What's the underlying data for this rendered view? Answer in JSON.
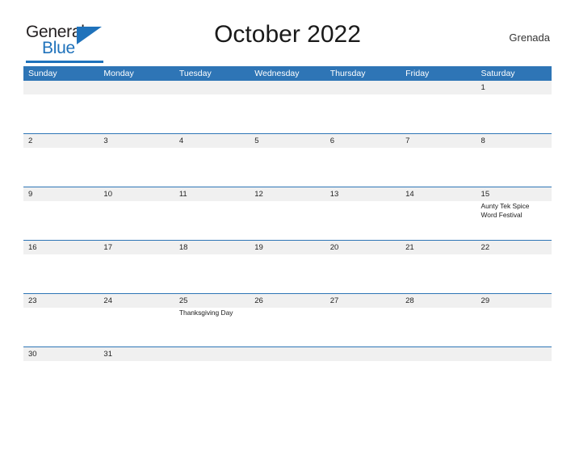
{
  "brand": {
    "name_part1": "General",
    "name_part2": "Blue"
  },
  "header": {
    "title": "October 2022",
    "location": "Grenada"
  },
  "calendar": {
    "weekdays": [
      "Sunday",
      "Monday",
      "Tuesday",
      "Wednesday",
      "Thursday",
      "Friday",
      "Saturday"
    ],
    "colors": {
      "header_blue": "#2E75B6",
      "band_gray": "#F0F0F0",
      "brand_blue": "#1F72BB",
      "text_dark": "#231F20"
    },
    "weeks": [
      {
        "days": [
          {
            "num": "",
            "events": []
          },
          {
            "num": "",
            "events": []
          },
          {
            "num": "",
            "events": []
          },
          {
            "num": "",
            "events": []
          },
          {
            "num": "",
            "events": []
          },
          {
            "num": "",
            "events": []
          },
          {
            "num": "1",
            "events": []
          }
        ]
      },
      {
        "days": [
          {
            "num": "2",
            "events": []
          },
          {
            "num": "3",
            "events": []
          },
          {
            "num": "4",
            "events": []
          },
          {
            "num": "5",
            "events": []
          },
          {
            "num": "6",
            "events": []
          },
          {
            "num": "7",
            "events": []
          },
          {
            "num": "8",
            "events": []
          }
        ]
      },
      {
        "days": [
          {
            "num": "9",
            "events": []
          },
          {
            "num": "10",
            "events": []
          },
          {
            "num": "11",
            "events": []
          },
          {
            "num": "12",
            "events": []
          },
          {
            "num": "13",
            "events": []
          },
          {
            "num": "14",
            "events": []
          },
          {
            "num": "15",
            "events": [
              "Aunty Tek Spice Word Festival"
            ]
          }
        ]
      },
      {
        "days": [
          {
            "num": "16",
            "events": []
          },
          {
            "num": "17",
            "events": []
          },
          {
            "num": "18",
            "events": []
          },
          {
            "num": "19",
            "events": []
          },
          {
            "num": "20",
            "events": []
          },
          {
            "num": "21",
            "events": []
          },
          {
            "num": "22",
            "events": []
          }
        ]
      },
      {
        "days": [
          {
            "num": "23",
            "events": []
          },
          {
            "num": "24",
            "events": []
          },
          {
            "num": "25",
            "events": [
              "Thanksgiving Day"
            ]
          },
          {
            "num": "26",
            "events": []
          },
          {
            "num": "27",
            "events": []
          },
          {
            "num": "28",
            "events": []
          },
          {
            "num": "29",
            "events": []
          }
        ]
      },
      {
        "short": true,
        "days": [
          {
            "num": "30",
            "events": []
          },
          {
            "num": "31",
            "events": []
          },
          {
            "num": "",
            "events": []
          },
          {
            "num": "",
            "events": []
          },
          {
            "num": "",
            "events": []
          },
          {
            "num": "",
            "events": []
          },
          {
            "num": "",
            "events": []
          }
        ]
      }
    ]
  }
}
